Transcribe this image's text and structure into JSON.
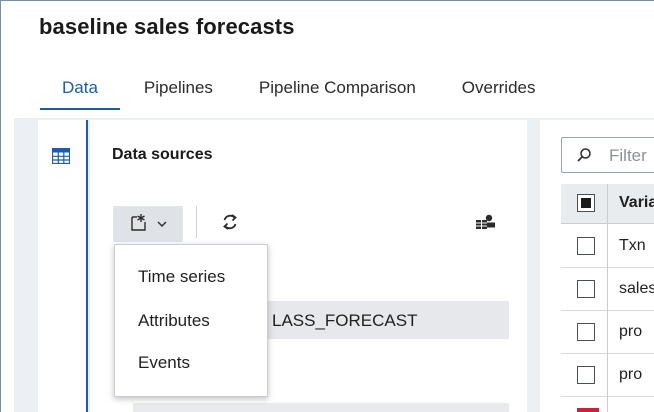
{
  "page": {
    "title": "baseline sales forecasts"
  },
  "tabs": [
    {
      "label": "Data",
      "active": true
    },
    {
      "label": "Pipelines",
      "active": false
    },
    {
      "label": "Pipeline Comparison",
      "active": false
    },
    {
      "label": "Overrides",
      "active": false
    }
  ],
  "rail": {
    "icon": "table-grid-icon"
  },
  "data_sources": {
    "title": "Data sources",
    "toolbar": {
      "add_icon": "add-data-icon",
      "dropdown_icon": "chevron-down-icon",
      "refresh_icon": "refresh-icon",
      "db_icon": "database-settings-icon"
    },
    "row_text": "LASS_FORECAST"
  },
  "add_menu": {
    "items": [
      "Time series",
      "Attributes",
      "Events"
    ]
  },
  "variables": {
    "filter_placeholder": "Filter",
    "header": "Variable",
    "rows": [
      "Txn",
      "sales",
      "pro",
      "pro"
    ]
  },
  "colors": {
    "accent": "#1a5ea8",
    "panel_bg": "#eceff3"
  }
}
